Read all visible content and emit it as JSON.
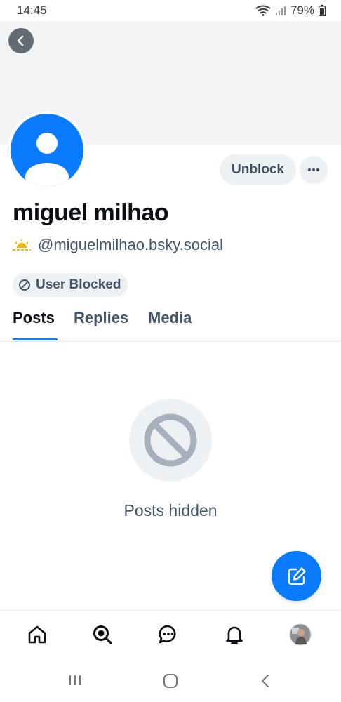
{
  "status_bar": {
    "time": "14:45",
    "battery": "79%"
  },
  "profile": {
    "display_name": "miguel milhao",
    "handle": "@miguelmilhao.bsky.social",
    "unblock_label": "Unblock",
    "blocked_badge": "User Blocked"
  },
  "tabs": [
    {
      "label": "Posts",
      "active": true
    },
    {
      "label": "Replies",
      "active": false
    },
    {
      "label": "Media",
      "active": false
    }
  ],
  "empty_state": {
    "text": "Posts hidden"
  },
  "colors": {
    "accent": "#0a7aff",
    "muted_text": "#43556a",
    "chip_bg": "#eef1f4",
    "banner_bg": "#f1f3f5"
  },
  "icons": {
    "back": "chevron-left-icon",
    "more": "ellipsis-icon",
    "handle_emoji": "sunrise-icon",
    "blocked": "block-icon",
    "empty": "block-icon",
    "compose": "compose-icon",
    "nav": [
      "home-icon",
      "search-icon",
      "chat-icon",
      "bell-icon",
      "avatar"
    ]
  }
}
